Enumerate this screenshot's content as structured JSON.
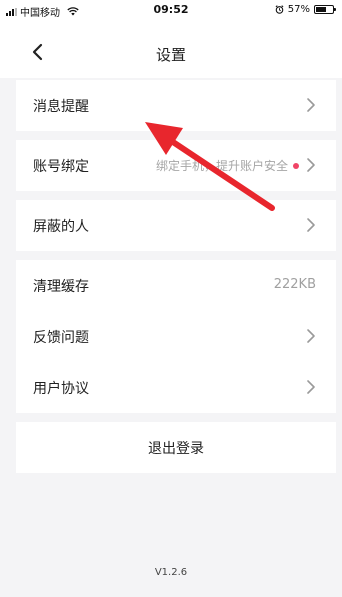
{
  "status_bar": {
    "carrier": "中国移动",
    "time": "09:52",
    "battery": "57%",
    "battery_level": 0.57
  },
  "nav": {
    "title": "设置"
  },
  "groups": {
    "notifications": {
      "label": "消息提醒"
    },
    "account": {
      "label": "账号绑定",
      "hint": "绑定手机，提升账户安全"
    },
    "blocked": {
      "label": "屏蔽的人"
    },
    "cache": {
      "label": "清理缓存",
      "value": "222KB"
    },
    "feedback": {
      "label": "反馈问题"
    },
    "agreement": {
      "label": "用户协议"
    }
  },
  "logout": {
    "label": "退出登录"
  },
  "version": "V1.2.6",
  "colors": {
    "accent_red": "#e8262d",
    "dot_red": "#f04466",
    "background": "#f4f4f6"
  }
}
